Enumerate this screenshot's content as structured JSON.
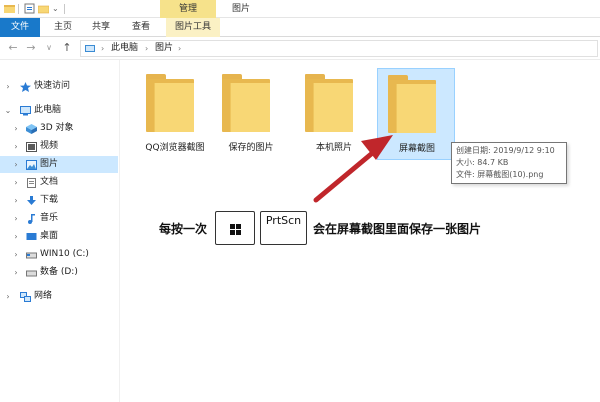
{
  "window": {
    "context_tab_label": "管理",
    "title": "图片"
  },
  "ribbon": {
    "tabs": [
      {
        "label": "文件"
      },
      {
        "label": "主页"
      },
      {
        "label": "共享"
      },
      {
        "label": "查看"
      },
      {
        "label": "图片工具"
      }
    ]
  },
  "address": {
    "nav": {
      "back": "←",
      "forward": "→",
      "recent": "∨",
      "up": "↑"
    },
    "breadcrumb": [
      {
        "label": "此电脑"
      },
      {
        "label": "图片"
      }
    ],
    "separator": "›"
  },
  "sidebar": {
    "items": [
      {
        "label": "快速访问",
        "icon": "star-icon"
      },
      {
        "label": "此电脑",
        "icon": "computer-icon"
      },
      {
        "label": "3D 对象",
        "icon": "3d-objects-icon"
      },
      {
        "label": "视频",
        "icon": "video-icon"
      },
      {
        "label": "图片",
        "icon": "pictures-icon",
        "selected": true
      },
      {
        "label": "文档",
        "icon": "documents-icon"
      },
      {
        "label": "下载",
        "icon": "download-icon"
      },
      {
        "label": "音乐",
        "icon": "music-icon"
      },
      {
        "label": "桌面",
        "icon": "desktop-icon"
      },
      {
        "label": "WIN10 (C:)",
        "icon": "drive-icon"
      },
      {
        "label": "数备 (D:)",
        "icon": "drive-icon"
      },
      {
        "label": "网络",
        "icon": "network-icon"
      }
    ]
  },
  "folders": [
    {
      "label": "QQ浏览器截图"
    },
    {
      "label": "保存的图片"
    },
    {
      "label": "本机照片"
    },
    {
      "label": "屏幕截图",
      "highlighted": true
    }
  ],
  "tooltip": {
    "created": "创建日期: 2019/9/12 9:10",
    "size": "大小: 84.7 KB",
    "files": "文件: 屏幕截图(10).png"
  },
  "annotation": {
    "before": "每按一次",
    "key": "PrtScn",
    "after": "会在屏幕截图里面保存一张图片",
    "windows_key_icon": "windows-logo-icon",
    "arrow_color": "#c0262b"
  },
  "colors": {
    "accent": "#1979ca",
    "selection": "#cce8ff",
    "folder": "#f8d775",
    "context_tab": "#f6e28b"
  }
}
